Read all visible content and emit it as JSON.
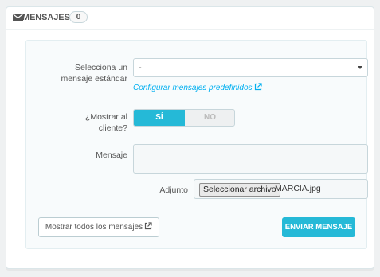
{
  "panel": {
    "title": "MENSAJES",
    "count": "0",
    "icon": "envelope-icon"
  },
  "form": {
    "select_label_line1": "Selecciona un",
    "select_label_line2": "mensaje estándar",
    "select_value": "-",
    "config_link": "Configurar mensajes predefinidos",
    "show_label_line1": "¿Mostrar al",
    "show_label_line2": "cliente?",
    "toggle_yes": "SÍ",
    "toggle_no": "NO",
    "toggle_selected": "yes",
    "message_label": "Mensaje",
    "message_value": "",
    "attachment_label": "Adjunto",
    "file_button": "Seleccionar archivo",
    "file_name": "MARCIA.jpg"
  },
  "actions": {
    "show_all": "Mostrar todos los mensajes",
    "send": "ENVIAR MENSAJE"
  },
  "colors": {
    "accent": "#25b9d7",
    "link": "#00aff0"
  }
}
